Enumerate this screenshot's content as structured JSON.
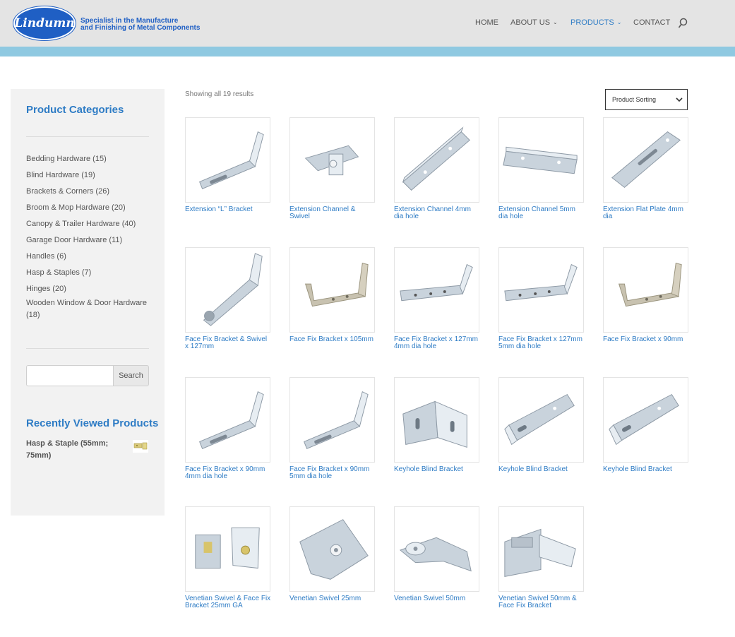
{
  "header": {
    "logo_text": "Lindumn",
    "tagline_line1": "Specialist in the Manufacture",
    "tagline_line2": "and Finishing of Metal Components",
    "nav": [
      {
        "label": "HOME",
        "active": false,
        "dropdown": false
      },
      {
        "label": "ABOUT US",
        "active": false,
        "dropdown": true
      },
      {
        "label": "PRODUCTS",
        "active": true,
        "dropdown": true
      },
      {
        "label": "CONTACT",
        "active": false,
        "dropdown": false
      }
    ],
    "search_icon": "search-icon"
  },
  "sidebar": {
    "categories_title": "Product Categories",
    "categories": [
      "Bedding Hardware (15)",
      "Blind Hardware (19)",
      "Brackets & Corners (26)",
      "Broom & Mop Hardware (20)",
      "Canopy & Trailer Hardware (40)",
      "Garage Door Hardware (11)",
      "Handles (6)",
      "Hasp & Staples (7)",
      "Hinges (20)",
      "Wooden Window & Door Hardware (18)"
    ],
    "search_placeholder": "",
    "search_button": "Search",
    "recent_title": "Recently Viewed Products",
    "recent_item": "Hasp & Staple (55mm; 75mm)"
  },
  "main": {
    "results_text": "Showing all 19 results",
    "sorting_label": "Product Sorting",
    "products": [
      {
        "name": "Extension “L” Bracket",
        "shape": "lbracket"
      },
      {
        "name": "Extension Channel & Swivel",
        "shape": "swivel"
      },
      {
        "name": "Extension Channel 4mm dia hole",
        "shape": "channel"
      },
      {
        "name": "Extension Channel 5mm dia hole",
        "shape": "channel2"
      },
      {
        "name": "Extension Flat Plate 4mm dia",
        "shape": "flat"
      },
      {
        "name": "Face Fix Bracket & Swivel x 127mm",
        "shape": "faceswivel"
      },
      {
        "name": "Face Fix Bracket x 105mm",
        "shape": "ubracket"
      },
      {
        "name": "Face Fix Bracket x 127mm 4mm dia hole",
        "shape": "longl"
      },
      {
        "name": "Face Fix Bracket x 127mm 5mm dia hole",
        "shape": "longl"
      },
      {
        "name": "Face Fix Bracket x 90mm",
        "shape": "ubracket"
      },
      {
        "name": "Face Fix Bracket x 90mm 4mm dia hole",
        "shape": "lbracket"
      },
      {
        "name": "Face Fix Bracket x 90mm 5mm dia hole",
        "shape": "lbracket"
      },
      {
        "name": "Keyhole Blind Bracket",
        "shape": "keyhole"
      },
      {
        "name": "Keyhole Blind Bracket",
        "shape": "keyhole2"
      },
      {
        "name": "Keyhole Blind Bracket",
        "shape": "keyhole2"
      },
      {
        "name": "Venetian Swivel & Face Fix Bracket 25mm GA",
        "shape": "venetian"
      },
      {
        "name": "Venetian Swivel 25mm",
        "shape": "plate"
      },
      {
        "name": "Venetian Swivel 50mm",
        "shape": "plate2"
      },
      {
        "name": "Venetian Swivel 50mm & Face Fix Bracket",
        "shape": "venetian2"
      }
    ]
  },
  "colors": {
    "accent": "#2e7cc5",
    "header_bg": "#e4e4e4",
    "header_strip": "#8fc9e1",
    "sidebar_bg": "#f2f2f2",
    "logo_blue": "#1f5fc4"
  }
}
